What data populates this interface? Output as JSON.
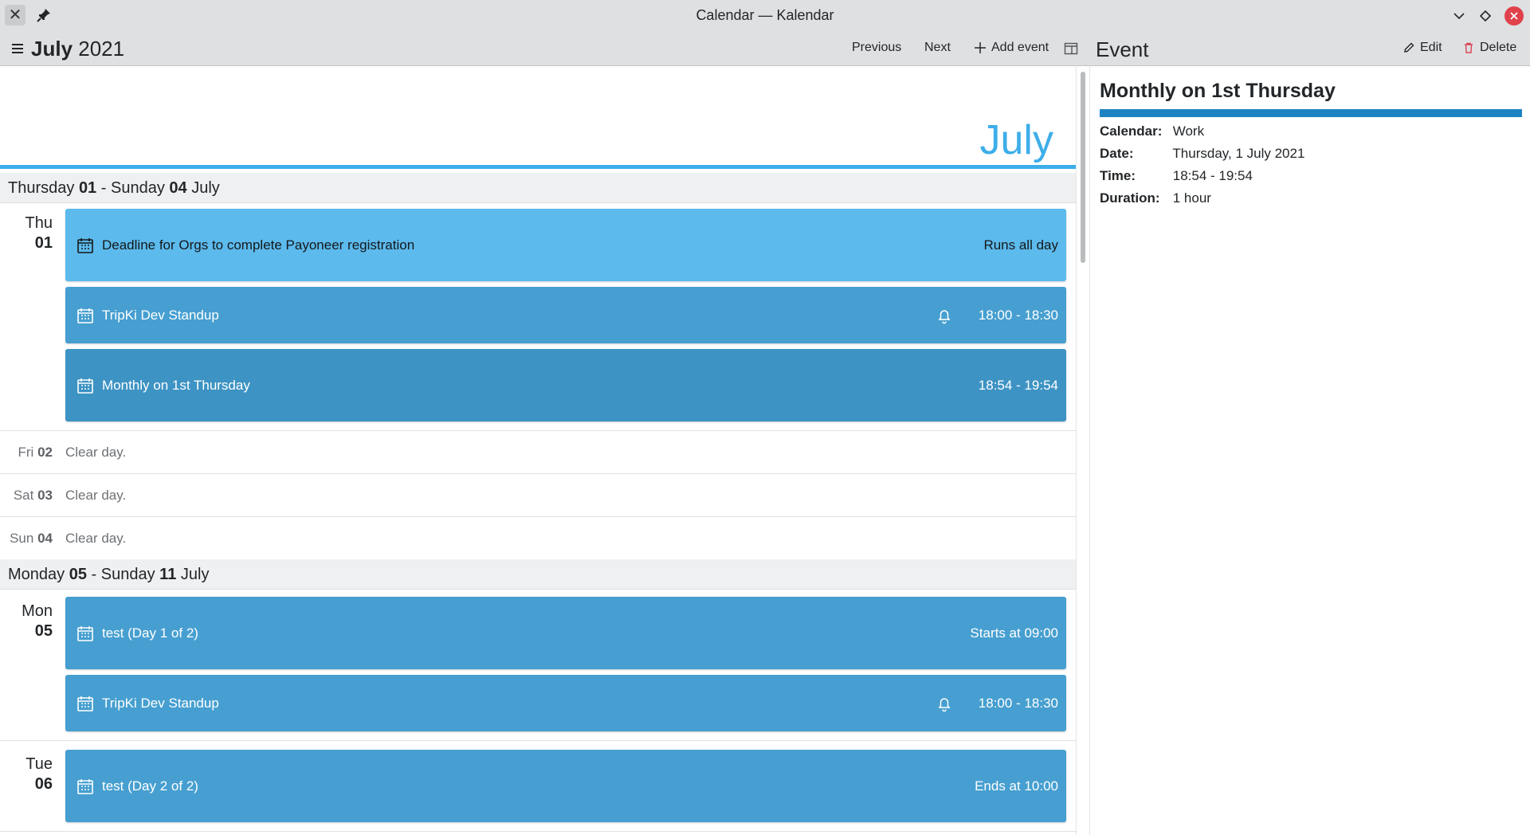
{
  "window": {
    "title": "Calendar — Kalendar"
  },
  "toolbar": {
    "month_bold": "July",
    "year": "2021",
    "previous": "Previous",
    "next": "Next",
    "add_event": "Add event",
    "panel_heading": "Event",
    "edit": "Edit",
    "delete": "Delete"
  },
  "month_banner": "July",
  "weeks": [
    {
      "label_start_day": "Thursday",
      "start_num": "01",
      "sep": "-",
      "label_end_day": "Sunday",
      "end_num": "04",
      "month": "July"
    },
    {
      "label_start_day": "Monday",
      "start_num": "05",
      "sep": "-",
      "label_end_day": "Sunday",
      "end_num": "11",
      "month": "July"
    }
  ],
  "days": {
    "thu": {
      "name": "Thu",
      "num": "01"
    },
    "fri": {
      "name": "Fri",
      "num": "02",
      "text": "Clear day."
    },
    "sat": {
      "name": "Sat",
      "num": "03",
      "text": "Clear day."
    },
    "sun": {
      "name": "Sun",
      "num": "04",
      "text": "Clear day."
    },
    "mon": {
      "name": "Mon",
      "num": "05"
    },
    "tue": {
      "name": "Tue",
      "num": "06"
    }
  },
  "events": [
    {
      "title": "Deadline for Orgs to complete Payoneer registration",
      "time": "Runs all day"
    },
    {
      "title": "TripKi Dev Standup",
      "time": "18:00 - 18:30"
    },
    {
      "title": "Monthly on 1st Thursday",
      "time": "18:54 - 19:54"
    },
    {
      "title": "test (Day 1 of 2)",
      "time": "Starts at 09:00"
    },
    {
      "title": "TripKi Dev Standup",
      "time": "18:00 - 18:30"
    },
    {
      "title": "test (Day 2 of 2)",
      "time": "Ends at 10:00"
    }
  ],
  "detail": {
    "title": "Monthly on 1st Thursday",
    "calendar_label": "Calendar:",
    "calendar_value": "Work",
    "date_label": "Date:",
    "date_value": "Thursday, 1 July 2021",
    "time_label": "Time:",
    "time_value": "18:54 - 19:54",
    "duration_label": "Duration:",
    "duration_value": "1 hour",
    "calendar_color": "#1d83c2"
  },
  "colors": {
    "accent": "#3daee9",
    "event_allday": "#5cbaec",
    "event": "#469fd0",
    "event_selected": "#3d93c3"
  }
}
